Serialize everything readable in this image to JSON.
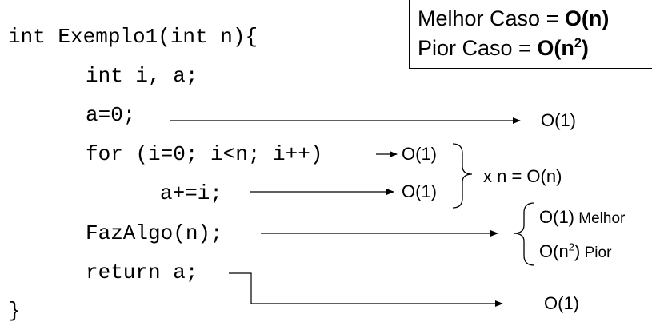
{
  "code": {
    "line1": "int Exemplo1(int n){",
    "line2": "int i, a;",
    "line3": "a=0;",
    "line4": "for (i=0; i<n; i++)",
    "line5": "a+=i;",
    "line6": "FazAlgo(n);",
    "line7": "return a;",
    "line8": "}"
  },
  "summary_box": {
    "best_label": "Melhor Caso = ",
    "best_value": "O(n)",
    "worst_label": "Pior Caso = ",
    "worst_value_base": "O(n",
    "worst_value_exp": "2",
    "worst_value_close": ")"
  },
  "annotations": {
    "assign": "O(1)",
    "loop_header": "O(1)",
    "loop_body": "O(1)",
    "loop_total": "x n = O(n)",
    "fazalgo_best_value": "O(1)",
    "fazalgo_best_word": " Melhor",
    "fazalgo_worst_base": "O(n",
    "fazalgo_worst_exp": "2",
    "fazalgo_worst_close": ")",
    "fazalgo_worst_word": " Pior",
    "return": "O(1)"
  }
}
